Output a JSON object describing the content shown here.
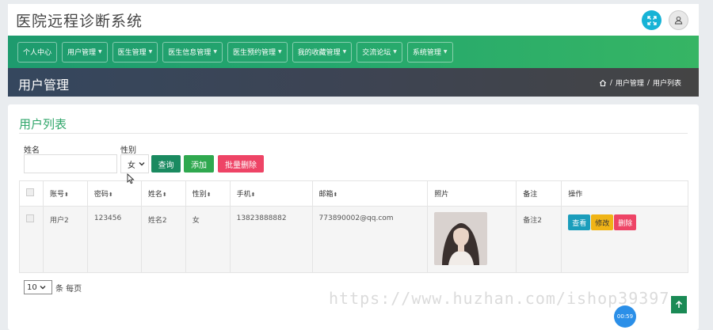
{
  "header": {
    "title": "医院远程诊断系统"
  },
  "nav": {
    "items": [
      "个人中心",
      "用户管理",
      "医生管理",
      "医生信息管理",
      "医生预约管理",
      "我的收藏管理",
      "交流论坛",
      "系统管理"
    ],
    "has_caret": [
      false,
      true,
      true,
      true,
      true,
      true,
      true,
      true
    ]
  },
  "page": {
    "title": "用户管理",
    "breadcrumb": [
      "用户管理",
      "用户列表"
    ],
    "sep": "/"
  },
  "card": {
    "title": "用户列表"
  },
  "search": {
    "name_label": "姓名",
    "name_value": "",
    "gender_label": "性别",
    "gender_value": "女",
    "query_label": "查询",
    "add_label": "添加",
    "batch_delete_label": "批量删除"
  },
  "table": {
    "headers": [
      "账号",
      "密码",
      "姓名",
      "性别",
      "手机",
      "邮箱",
      "照片",
      "备注",
      "操作"
    ],
    "rows": [
      {
        "account": "用户2",
        "password": "123456",
        "name": "姓名2",
        "gender": "女",
        "phone": "13823888882",
        "email": "773890002@qq.com",
        "note": "备注2",
        "actions": [
          "查看",
          "修改",
          "删除"
        ]
      }
    ]
  },
  "pagination": {
    "page_size": "10",
    "page_size_label": "条 每页"
  },
  "overlay": {
    "watermark": "https://www.huzhan.com/ishop39397",
    "timer": "00:59"
  },
  "colors": {
    "nav_green": "#25a86d",
    "title_green": "#2fa66a",
    "query": "#1a8a60",
    "add": "#2fa84f",
    "danger": "#ee4466",
    "info": "#1b9dbb",
    "warning": "#f0b416"
  }
}
